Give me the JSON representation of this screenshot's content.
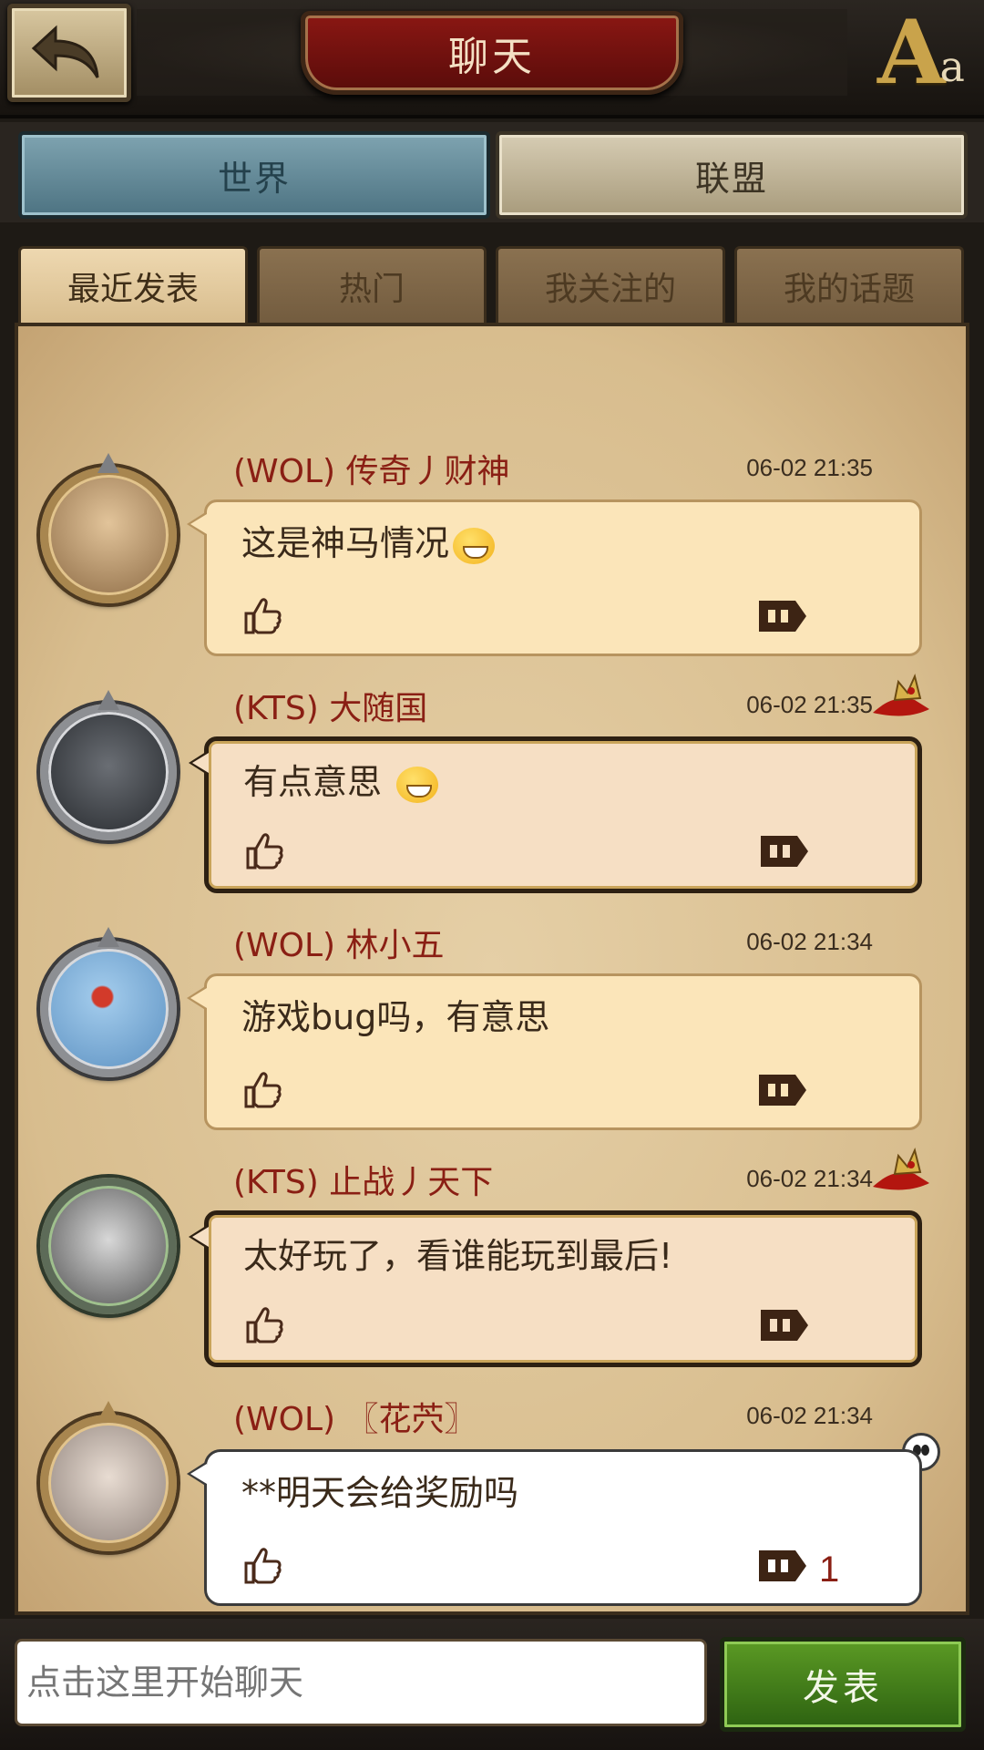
{
  "header": {
    "title": "聊天",
    "back_icon": "back-arrow-icon",
    "font_icon": {
      "big": "A",
      "small": "a"
    }
  },
  "channels": [
    {
      "label": "世界",
      "active": true
    },
    {
      "label": "联盟",
      "active": false
    }
  ],
  "subtabs": [
    {
      "label": "最近发表",
      "active": true
    },
    {
      "label": "热门",
      "active": false
    },
    {
      "label": "我关注的",
      "active": false
    },
    {
      "label": "我的话题",
      "active": false
    }
  ],
  "messages": [
    {
      "sender": "(WOL) 传奇丿财神",
      "time": "06-02 21:35",
      "text": "这是神马情况",
      "emoji": "grin-emoji",
      "style": "normal"
    },
    {
      "sender": "(KTS) 大随国",
      "time": "06-02 21:35",
      "text": "有点意思 ",
      "emoji": "laugh-emoji",
      "style": "vip"
    },
    {
      "sender": "(WOL) 林小五",
      "time": "06-02 21:34",
      "text": "游戏bug吗，有意思",
      "style": "normal"
    },
    {
      "sender": "(KTS) 止战丿天下",
      "time": "06-02 21:34",
      "text": "太好玩了，看谁能玩到最后!",
      "style": "vip"
    },
    {
      "sender": "(WOL) 〖花茓〗",
      "time": "06-02 21:34",
      "text": "**明天会给奖励吗",
      "style": "white",
      "reply_count": "1"
    }
  ],
  "composer": {
    "placeholder": "点击这里开始聊天",
    "send_label": "发表"
  },
  "colors": {
    "sender": "#8a1f14",
    "world_tab": "#5f8796",
    "send_button": "#3f7a1a"
  }
}
